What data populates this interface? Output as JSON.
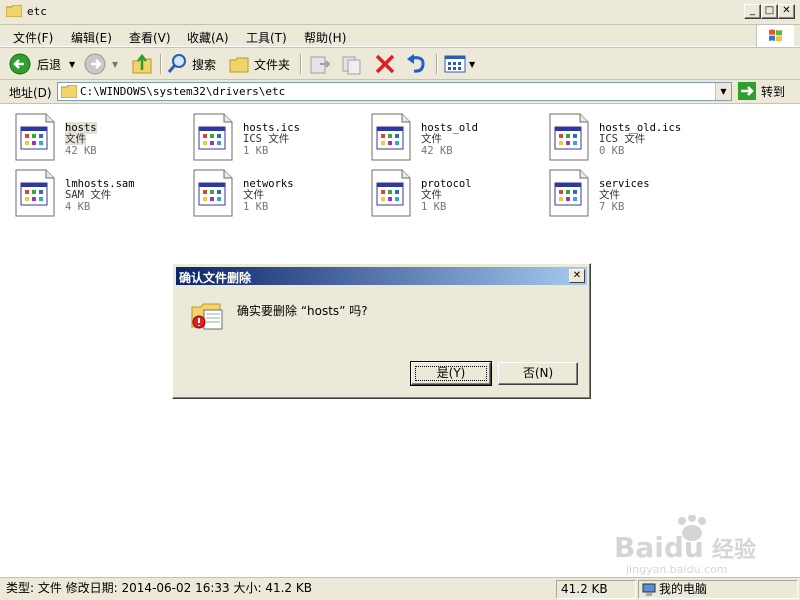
{
  "window": {
    "title": "etc",
    "min_glyph": "_",
    "max_glyph": "□",
    "close_glyph": "✕"
  },
  "menu": {
    "items": [
      "文件(F)",
      "编辑(E)",
      "查看(V)",
      "收藏(A)",
      "工具(T)",
      "帮助(H)"
    ]
  },
  "toolbar": {
    "back_label": "后退",
    "search_label": "搜索",
    "folders_label": "文件夹"
  },
  "address": {
    "label": "地址(D)",
    "path": "C:\\WINDOWS\\system32\\drivers\\etc",
    "go_label": "转到"
  },
  "files": [
    {
      "name": "hosts",
      "type": "文件",
      "size": "42 KB",
      "selected": true
    },
    {
      "name": "hosts.ics",
      "type": "ICS 文件",
      "size": "1 KB"
    },
    {
      "name": "hosts_old",
      "type": "文件",
      "size": "42 KB"
    },
    {
      "name": "hosts_old.ics",
      "type": "ICS 文件",
      "size": "0 KB"
    },
    {
      "name": "lmhosts.sam",
      "type": "SAM 文件",
      "size": "4 KB"
    },
    {
      "name": "networks",
      "type": "文件",
      "size": "1 KB"
    },
    {
      "name": "protocol",
      "type": "文件",
      "size": "1 KB"
    },
    {
      "name": "services",
      "type": "文件",
      "size": "7 KB"
    }
  ],
  "dialog": {
    "title": "确认文件删除",
    "message": "确实要删除 “hosts” 吗?",
    "yes_label": "是(Y)",
    "no_label": "否(N)",
    "close_glyph": "✕"
  },
  "statusbar": {
    "info": "类型: 文件 修改日期: 2014-06-02 16:33 大小: 41.2 KB",
    "size": "41.2 KB",
    "location": "我的电脑"
  },
  "watermark": {
    "brand": "Baidu",
    "brand_cn": "经验",
    "url": "jingyan.baidu.com"
  },
  "colors": {
    "chrome": "#ece9d8",
    "dialog_title_start": "#0a246a",
    "dialog_title_end": "#a6caf0",
    "delete_red": "#e02020",
    "back_green": "#2e9e2e"
  }
}
